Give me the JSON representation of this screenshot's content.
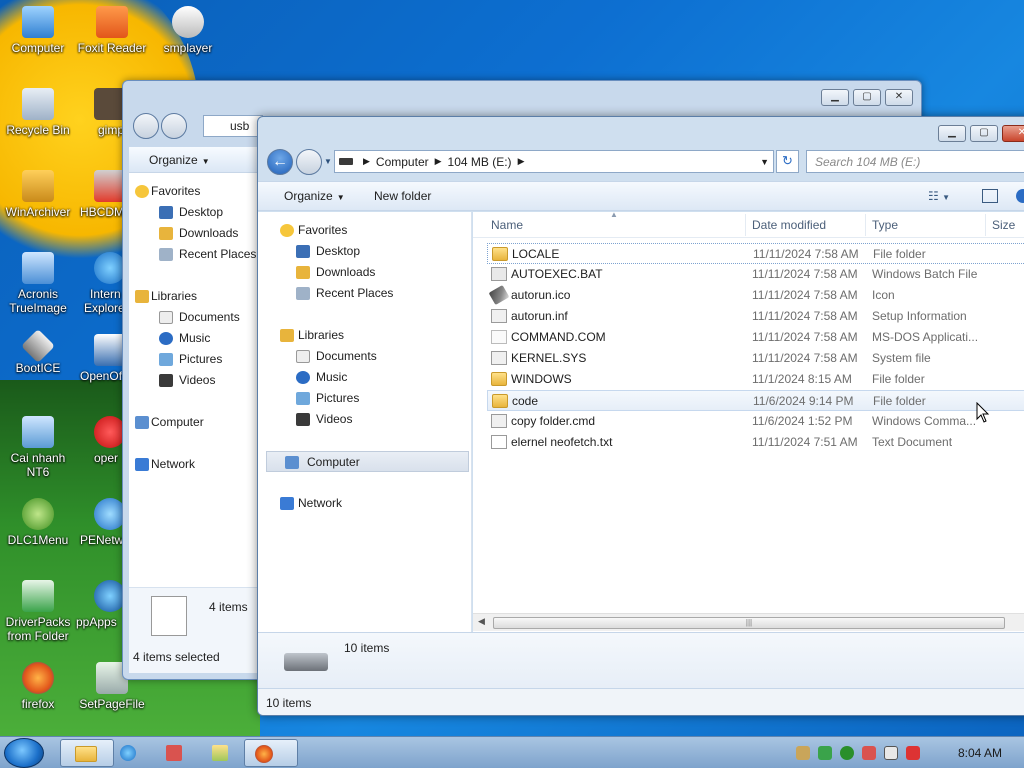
{
  "desktop": {
    "icons": [
      {
        "label": "Computer"
      },
      {
        "label": "Foxit Reader"
      },
      {
        "label": "smplayer"
      },
      {
        "label": "Recycle Bin"
      },
      {
        "label": "gimp"
      },
      {
        "label": "WinArchiver"
      },
      {
        "label": "HBCDM"
      },
      {
        "label": "Acronis TrueImage"
      },
      {
        "label": "Intern Explore"
      },
      {
        "label": "BootICE"
      },
      {
        "label": "OpenOf"
      },
      {
        "label": "Cai nhanh NT6"
      },
      {
        "label": "oper"
      },
      {
        "label": "DLC1Menu"
      },
      {
        "label": "PENetw"
      },
      {
        "label": "DriverPacks from Folder"
      },
      {
        "label": "ppApps"
      },
      {
        "label": "firefox"
      },
      {
        "label": "SetPageFile"
      }
    ]
  },
  "back_window": {
    "address_text": "usb",
    "toolbar": {
      "organize": "Organize"
    },
    "nav": {
      "favorites": "Favorites",
      "desktop": "Desktop",
      "downloads": "Downloads",
      "recent": "Recent Places",
      "libraries": "Libraries",
      "documents": "Documents",
      "music": "Music",
      "pictures": "Pictures",
      "videos": "Videos",
      "computer": "Computer",
      "network": "Network"
    },
    "details_count": "4 items",
    "status": "4 items selected"
  },
  "front_window": {
    "breadcrumb": [
      "Computer",
      "104 MB (E:)"
    ],
    "search_placeholder": "Search 104 MB (E:)",
    "toolbar": {
      "organize": "Organize",
      "new_folder": "New folder"
    },
    "nav": {
      "favorites": "Favorites",
      "desktop": "Desktop",
      "downloads": "Downloads",
      "recent": "Recent Places",
      "libraries": "Libraries",
      "documents": "Documents",
      "music": "Music",
      "pictures": "Pictures",
      "videos": "Videos",
      "computer": "Computer",
      "network": "Network"
    },
    "columns": {
      "name": "Name",
      "date": "Date modified",
      "type": "Type",
      "size": "Size"
    },
    "files": [
      {
        "name": "LOCALE",
        "date": "11/11/2024 7:58 AM",
        "type": "File folder",
        "icon": "folder-icon"
      },
      {
        "name": "AUTOEXEC.BAT",
        "date": "11/11/2024 7:58 AM",
        "type": "Windows Batch File",
        "icon": "batch-file-icon"
      },
      {
        "name": "autorun.ico",
        "date": "11/11/2024 7:58 AM",
        "type": "Icon",
        "icon": "ico-file-icon"
      },
      {
        "name": "autorun.inf",
        "date": "11/11/2024 7:58 AM",
        "type": "Setup Information",
        "icon": "setup-info-icon"
      },
      {
        "name": "COMMAND.COM",
        "date": "11/11/2024 7:58 AM",
        "type": "MS-DOS Applicati...",
        "icon": "dos-app-icon"
      },
      {
        "name": "KERNEL.SYS",
        "date": "11/11/2024 7:58 AM",
        "type": "System file",
        "icon": "system-file-icon"
      },
      {
        "name": "WINDOWS",
        "date": "11/1/2024 8:15 AM",
        "type": "File folder",
        "icon": "folder-icon"
      },
      {
        "name": "code",
        "date": "11/6/2024 9:14 PM",
        "type": "File folder",
        "icon": "folder-icon"
      },
      {
        "name": "copy folder.cmd",
        "date": "11/6/2024 1:52 PM",
        "type": "Windows Comma...",
        "icon": "cmd-file-icon"
      },
      {
        "name": "elernel neofetch.txt",
        "date": "11/11/2024 7:51 AM",
        "type": "Text Document",
        "icon": "text-file-icon"
      }
    ],
    "details_count": "10 items",
    "status": "10 items"
  },
  "taskbar": {
    "clock": "8:04 AM"
  },
  "colors": {
    "accent": "#1f5fb8",
    "folder": "#e8b43c"
  }
}
